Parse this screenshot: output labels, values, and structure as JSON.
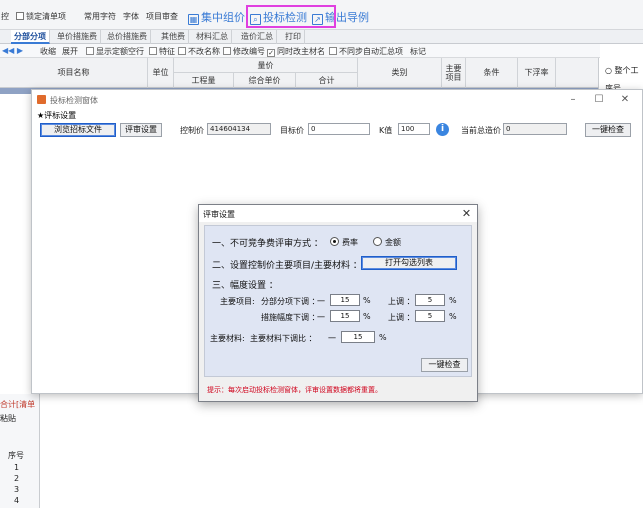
{
  "toolbar": {
    "control": "控",
    "lock_list": "锁定清单项",
    "common_chars": "常用字符",
    "font": "字体",
    "project_review": "项目审查",
    "group_price": "集中组价",
    "bid_detect": "投标检测",
    "export_guide": "输出导例"
  },
  "tabs": [
    {
      "label": "分部分项"
    },
    {
      "label": "单价措施费"
    },
    {
      "label": "总价措施费"
    },
    {
      "label": "其他费"
    },
    {
      "label": "材料汇总"
    },
    {
      "label": "造价汇总"
    },
    {
      "label": "打印"
    }
  ],
  "options": {
    "collapse": "收缩",
    "expand": "展开",
    "show_seq_row": "显示定额空行",
    "features": "特征",
    "no_rename": "不改名称",
    "change_code": "修改编号",
    "change_main_material": "同时改主材名",
    "no_sync_summary": "不同步自动汇总项",
    "mark": "标记"
  },
  "grid": {
    "col_name": "项目名称",
    "col_unit": "单位",
    "col_price_group": "量价",
    "col_quantity": "工程量",
    "col_unit_price": "综合单价",
    "col_total": "合计",
    "col_category": "类别",
    "col_main_item": "主要项目",
    "col_condition": "条件",
    "col_float": "下浮率"
  },
  "right_panel": {
    "whole": "整个工",
    "seq": "序号"
  },
  "bottom_panel": {
    "total_label": "合计[清单",
    "paste": "粘贴",
    "seq_header": "序号",
    "rows": [
      "1",
      "2",
      "3",
      "4"
    ]
  },
  "main_window": {
    "title": "投标检测窗体",
    "section_label": "★评标设置",
    "browse_button": "浏览招标文件",
    "review_settings_button": "评审设置",
    "control_price_label": "控制价",
    "control_price_value": "414604134",
    "target_price_label": "目标价",
    "target_price_value": "0",
    "k_label": "K值",
    "k_value": "100",
    "current_total_label": "当前总造价",
    "current_total_value": "0",
    "one_click_check_button": "一键检查"
  },
  "dialog": {
    "title": "评审设置",
    "section1": "一、不可竞争费评审方式 ：",
    "radio_rate": "费率",
    "radio_amount": "金额",
    "radio_selected": "rate",
    "section2": "二、设置控制价主要项目/主要材料 ：",
    "open_list_button": "打开勾选列表",
    "section3": "三、幅度设置 ：",
    "main_items_label": "主要项目:",
    "fenbu_down_label": "分部分项下调 ：",
    "fenbu_down_value": "15",
    "measure_down_label": "措施幅度下调 ：",
    "measure_down_value": "15",
    "up_label": "上调 ：",
    "fenbu_up_value": "5",
    "measure_up_value": "5",
    "main_materials_label": "主要材料:",
    "material_down_label": "主要材料下调比 ：",
    "material_down_value": "15",
    "minus": "一",
    "percent": "%",
    "one_click_check_button": "一键检查",
    "tip": "提示：每次启动投标检测窗体，评审设置数据都将重置。"
  }
}
